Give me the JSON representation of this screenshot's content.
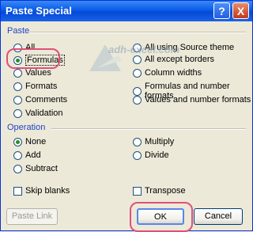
{
  "window": {
    "title": "Paste Special",
    "help": "?",
    "close": "X"
  },
  "paste_group": {
    "label": "Paste",
    "left": [
      "All",
      "Formulas",
      "Values",
      "Formats",
      "Comments",
      "Validation"
    ],
    "right": [
      "All using Source theme",
      "All except borders",
      "Column widths",
      "Formulas and number formats",
      "Values and number formats"
    ],
    "selected": "Formulas"
  },
  "operation_group": {
    "label": "Operation",
    "left": [
      "None",
      "Add",
      "Subtract"
    ],
    "right": [
      "Multiply",
      "Divide"
    ],
    "selected": "None"
  },
  "options": {
    "skip_blanks": "Skip blanks",
    "transpose": "Transpose"
  },
  "buttons": {
    "paste_link": "Paste Link",
    "ok": "OK",
    "cancel": "Cancel"
  },
  "watermark": "adh-excel.com",
  "colors": {
    "title_bar": "#0a5ce8",
    "group_label": "#1f44c8",
    "highlight": "#e0507a",
    "radio_dot": "#2a8a26"
  }
}
